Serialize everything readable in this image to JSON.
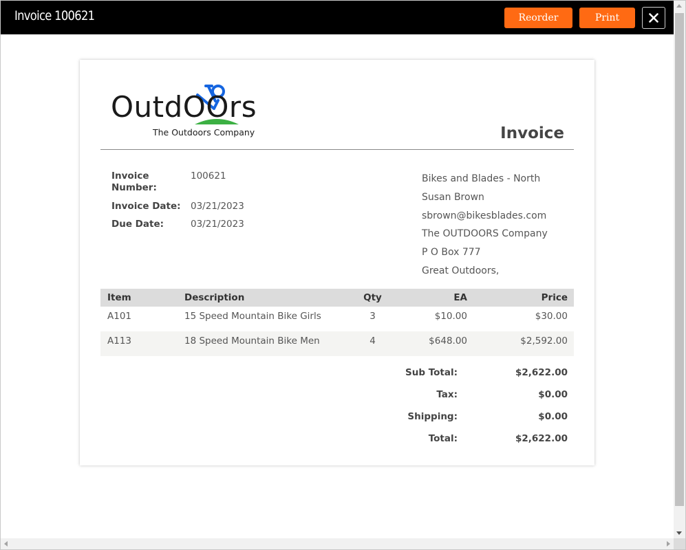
{
  "window": {
    "title": "Invoice 100621",
    "buttons": {
      "reorder": "Reorder",
      "print": "Print"
    }
  },
  "logo": {
    "wordmark": "OutdOOrs",
    "tagline": "The Outdoors Company"
  },
  "invoice": {
    "heading": "Invoice",
    "number_label": "Invoice Number:",
    "number": "100621",
    "date_label": "Invoice Date:",
    "date": "03/21/2023",
    "due_label": "Due Date:",
    "due": "03/21/2023"
  },
  "bill_to": {
    "lines": [
      "Bikes and Blades - North",
      "Susan Brown",
      "sbrown@bikesblades.com",
      "The OUTDOORS Company",
      "P O Box 777",
      "Great Outdoors,"
    ]
  },
  "table": {
    "headers": {
      "item": "Item",
      "description": "Description",
      "qty": "Qty",
      "ea": "EA",
      "price": "Price"
    },
    "rows": [
      {
        "item": "A101",
        "description": "15 Speed Mountain Bike Girls",
        "qty": "3",
        "ea": "$10.00",
        "price": "$30.00"
      },
      {
        "item": "A113",
        "description": "18 Speed Mountain Bike Men",
        "qty": "4",
        "ea": "$648.00",
        "price": "$2,592.00"
      }
    ]
  },
  "totals": {
    "subtotal_label": "Sub Total:",
    "subtotal": "$2,622.00",
    "tax_label": "Tax:",
    "tax": "$0.00",
    "shipping_label": "Shipping:",
    "shipping": "$0.00",
    "total_label": "Total:",
    "total": "$2,622.00"
  },
  "colors": {
    "accent": "#ff6a13",
    "logo_blue": "#1565e0",
    "logo_green": "#3cb043",
    "titlebar": "#000000"
  },
  "icons": {
    "close": "close-icon",
    "logo_bike": "bicycle-icon"
  }
}
